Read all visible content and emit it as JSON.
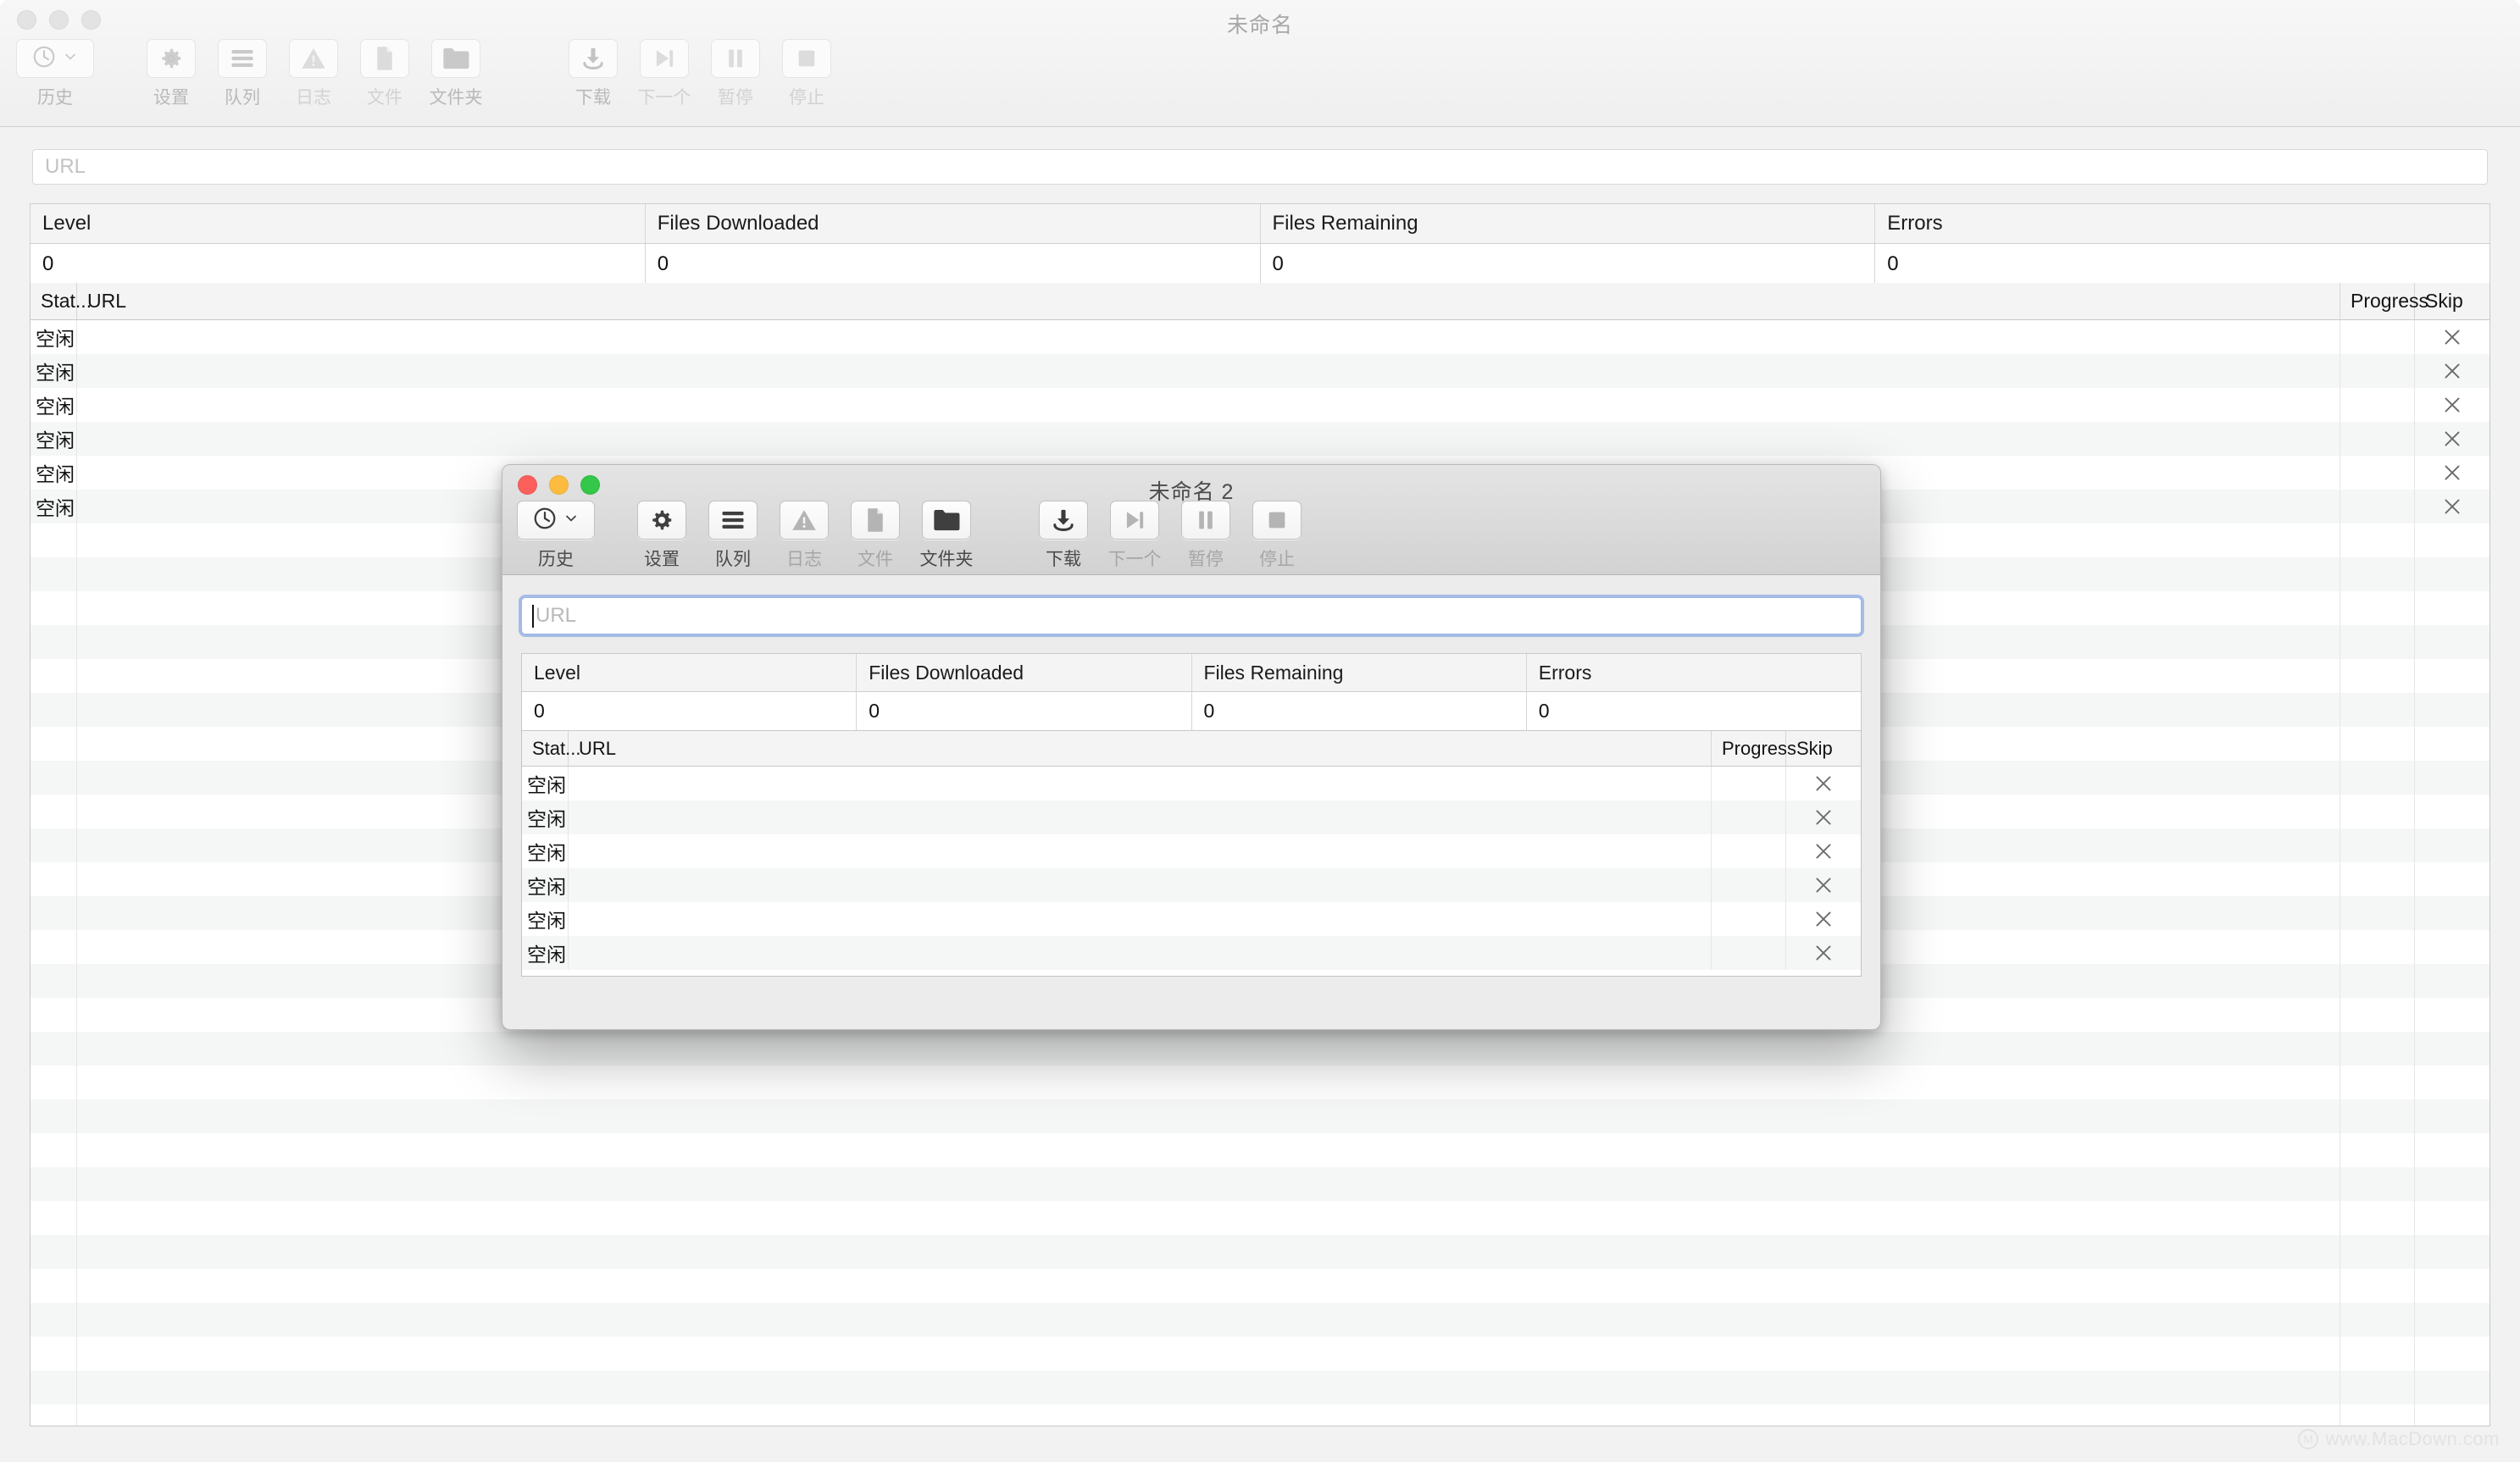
{
  "background_window": {
    "title": "未命名",
    "traffic_lights": [
      "close",
      "minimize",
      "zoom"
    ],
    "toolbar": {
      "history": {
        "label": "历史",
        "icon": "clock-icon",
        "chevron": "chevron-down-icon"
      },
      "items": [
        {
          "label": "设置",
          "icon": "gear-icon",
          "enabled": true
        },
        {
          "label": "队列",
          "icon": "list-icon",
          "enabled": true
        },
        {
          "label": "日志",
          "icon": "warning-icon",
          "enabled": false
        },
        {
          "label": "文件",
          "icon": "file-icon",
          "enabled": false
        },
        {
          "label": "文件夹",
          "icon": "folder-icon",
          "enabled": true
        }
      ],
      "transport": [
        {
          "label": "下载",
          "icon": "download-icon",
          "enabled": true
        },
        {
          "label": "下一个",
          "icon": "next-icon",
          "enabled": false
        },
        {
          "label": "暂停",
          "icon": "pause-icon",
          "enabled": false
        },
        {
          "label": "停止",
          "icon": "stop-icon",
          "enabled": false
        }
      ]
    },
    "url_input": {
      "value": "",
      "placeholder": "URL"
    },
    "stats": {
      "headers": [
        "Level",
        "Files Downloaded",
        "Files Remaining",
        "Errors"
      ],
      "values": [
        "0",
        "0",
        "0",
        "0"
      ]
    },
    "queue": {
      "headers": [
        "Stat...",
        "URL",
        "Progress",
        "Skip"
      ],
      "rows": [
        {
          "status": "空闲",
          "url": "",
          "progress": "",
          "skip": "×"
        },
        {
          "status": "空闲",
          "url": "",
          "progress": "",
          "skip": "×"
        },
        {
          "status": "空闲",
          "url": "",
          "progress": "",
          "skip": "×"
        },
        {
          "status": "空闲",
          "url": "",
          "progress": "",
          "skip": "×"
        },
        {
          "status": "空闲",
          "url": "",
          "progress": "",
          "skip": "×"
        },
        {
          "status": "空闲",
          "url": "",
          "progress": "",
          "skip": "×"
        }
      ],
      "empty_rows": 27
    }
  },
  "modal_window": {
    "title": "未命名 2",
    "traffic_lights": [
      "close",
      "minimize",
      "zoom"
    ],
    "toolbar": {
      "history": {
        "label": "历史",
        "icon": "clock-icon",
        "chevron": "chevron-down-icon"
      },
      "items": [
        {
          "label": "设置",
          "icon": "gear-icon",
          "enabled": true
        },
        {
          "label": "队列",
          "icon": "list-icon",
          "enabled": true
        },
        {
          "label": "日志",
          "icon": "warning-icon",
          "enabled": false
        },
        {
          "label": "文件",
          "icon": "file-icon",
          "enabled": false
        },
        {
          "label": "文件夹",
          "icon": "folder-icon",
          "enabled": true
        }
      ],
      "transport": [
        {
          "label": "下载",
          "icon": "download-icon",
          "enabled": true
        },
        {
          "label": "下一个",
          "icon": "next-icon",
          "enabled": false
        },
        {
          "label": "暂停",
          "icon": "pause-icon",
          "enabled": false
        },
        {
          "label": "停止",
          "icon": "stop-icon",
          "enabled": false
        }
      ]
    },
    "url_input": {
      "value": "",
      "placeholder": "URL",
      "focused": true
    },
    "stats": {
      "headers": [
        "Level",
        "Files Downloaded",
        "Files Remaining",
        "Errors"
      ],
      "values": [
        "0",
        "0",
        "0",
        "0"
      ]
    },
    "queue": {
      "headers": [
        "Stat...",
        "URL",
        "Progress",
        "Skip"
      ],
      "rows": [
        {
          "status": "空闲",
          "url": "",
          "progress": "",
          "skip": "×"
        },
        {
          "status": "空闲",
          "url": "",
          "progress": "",
          "skip": "×"
        },
        {
          "status": "空闲",
          "url": "",
          "progress": "",
          "skip": "×"
        },
        {
          "status": "空闲",
          "url": "",
          "progress": "",
          "skip": "×"
        },
        {
          "status": "空闲",
          "url": "",
          "progress": "",
          "skip": "×"
        },
        {
          "status": "空闲",
          "url": "",
          "progress": "",
          "skip": "×"
        }
      ]
    }
  },
  "watermark": {
    "text": "www.MacDown.com",
    "mark": "M"
  },
  "colors": {
    "accent_focus_ring": "#6e96e1",
    "traffic_red": "#fc605c",
    "traffic_yellow": "#fdbc40",
    "traffic_green": "#34c749",
    "toolbar_bg": "#e4e4e4",
    "table_stripe": "#f5f6f6"
  }
}
